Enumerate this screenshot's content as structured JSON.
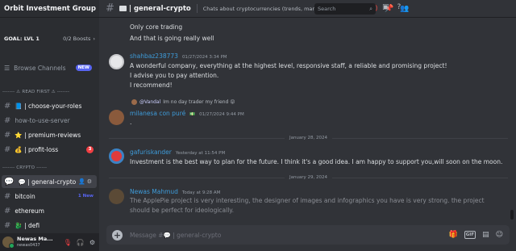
{
  "server": {
    "name": "Orbit Investment Group",
    "goal": "GOAL: LVL 1",
    "boosts": "0/2 Boosts"
  },
  "sidebar": {
    "browse": "Browse Channels",
    "browse_badge": "NEW",
    "category_read_first": "------- ⚠ READ FIRST ⚠ -------",
    "category_crypto": "------- CRYPTO ------",
    "channels": [
      {
        "label": "📘 | choose-your-roles"
      },
      {
        "label": "how-to-use-server"
      },
      {
        "label": "⭐ | premium-reviews"
      },
      {
        "label": "💰 | profit-loss",
        "unread": "3"
      },
      {
        "label": "💬 | general-crypto"
      },
      {
        "label": "bitcoin",
        "badge": "1 New"
      },
      {
        "label": "ethereum"
      },
      {
        "label": "🐉 | defi"
      }
    ]
  },
  "user": {
    "name": "Newas Ma...",
    "tag": "newas0437"
  },
  "header": {
    "channel": "| general-crypto",
    "topic": "Chats about cryptocurrencies (trends, market and toke...",
    "search_placeholder": "Search"
  },
  "messages": {
    "top_lines": [
      "Only core trading",
      "And that is going really well"
    ],
    "m1": {
      "author": "shahbaz238773",
      "time": "01/27/2024 3:34 PM",
      "lines": [
        "A wonderful company, everything at the highest level, responsive staff, a reliable and promising project!",
        "I advise you to pay attention.",
        "I recommend!"
      ]
    },
    "m2": {
      "reply_to": "@Vandal",
      "reply_text": "Im no day trader my friend 😝",
      "author": "milanesa con puré",
      "badge": "💵",
      "time": "01/27/2024 9:44 PM",
      "lines": [
        "."
      ]
    },
    "day1": "January 28, 2024",
    "m3": {
      "author": "gafuriskander",
      "time": "Yesterday at 11:54 PM",
      "lines": [
        "Investment is the best way to plan for the future. I think it's a good idea. I am happy to support you,will soon on the moon."
      ]
    },
    "day2": "January 29, 2024",
    "m4": {
      "author": "Newas Mahmud",
      "time": "Today at 9:28 AM",
      "lines": [
        "The ApplePie project is very interesting, the designer of images and infographics you have is very strong. the project",
        "should be perfect for ideologically."
      ]
    }
  },
  "composer": {
    "placeholder": "Message #💬 | general-crypto",
    "gif": "GIF"
  }
}
